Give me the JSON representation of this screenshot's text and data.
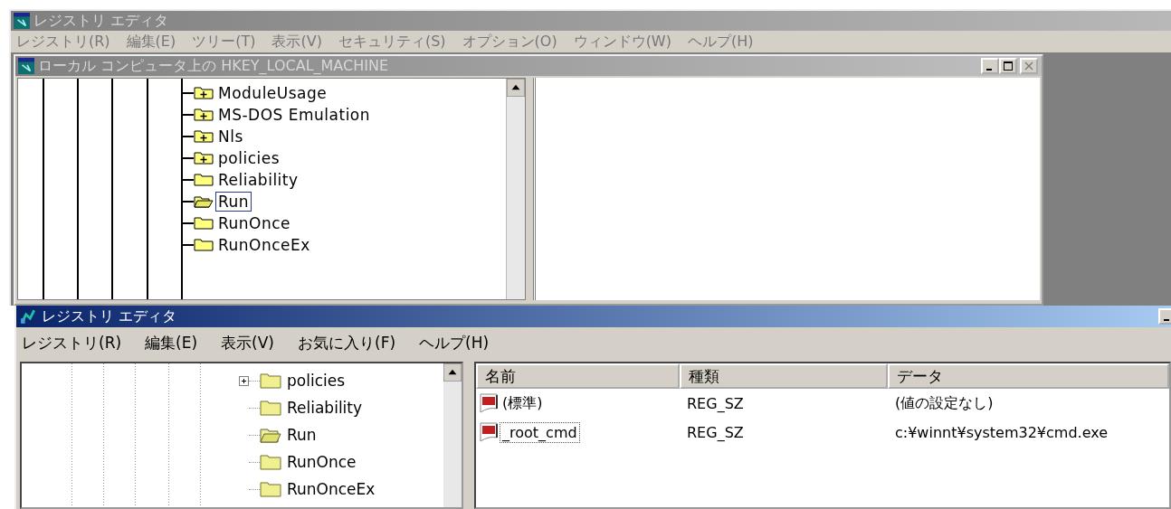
{
  "back_window": {
    "title": "レジストリ エディタ",
    "menu": [
      "レジストリ(R)",
      "編集(E)",
      "ツリー(T)",
      "表示(V)",
      "セキュリティ(S)",
      "オプション(O)",
      "ウィンドウ(W)",
      "ヘルプ(H)"
    ],
    "child_window": {
      "title": "ローカル コンピュータ上の HKEY_LOCAL_MACHINE",
      "tree": [
        {
          "label": "ModuleUsage",
          "expandable": true,
          "selected": false
        },
        {
          "label": "MS-DOS Emulation",
          "expandable": true,
          "selected": false
        },
        {
          "label": "Nls",
          "expandable": true,
          "selected": false
        },
        {
          "label": "policies",
          "expandable": true,
          "selected": false
        },
        {
          "label": "Reliability",
          "expandable": false,
          "selected": false
        },
        {
          "label": "Run",
          "expandable": false,
          "selected": true
        },
        {
          "label": "RunOnce",
          "expandable": false,
          "selected": false
        },
        {
          "label": "RunOnceEx",
          "expandable": false,
          "selected": false
        }
      ]
    }
  },
  "front_window": {
    "title": "レジストリ エディタ",
    "menu": [
      "レジストリ(R)",
      "編集(E)",
      "表示(V)",
      "お気に入り(F)",
      "ヘルプ(H)"
    ],
    "tree": [
      {
        "label": "policies",
        "expandable": true,
        "selected": false
      },
      {
        "label": "Reliability",
        "expandable": false,
        "selected": false
      },
      {
        "label": "Run",
        "expandable": false,
        "selected": true
      },
      {
        "label": "RunOnce",
        "expandable": false,
        "selected": false
      },
      {
        "label": "RunOnceEx",
        "expandable": false,
        "selected": false
      }
    ],
    "list": {
      "columns": [
        "名前",
        "種類",
        "データ"
      ],
      "rows": [
        {
          "name": "(標準)",
          "type": "REG_SZ",
          "data": "(値の設定なし)",
          "selected": false
        },
        {
          "name": "_root_cmd",
          "type": "REG_SZ",
          "data": "c:¥winnt¥system32¥cmd.exe",
          "selected": true
        }
      ]
    }
  }
}
